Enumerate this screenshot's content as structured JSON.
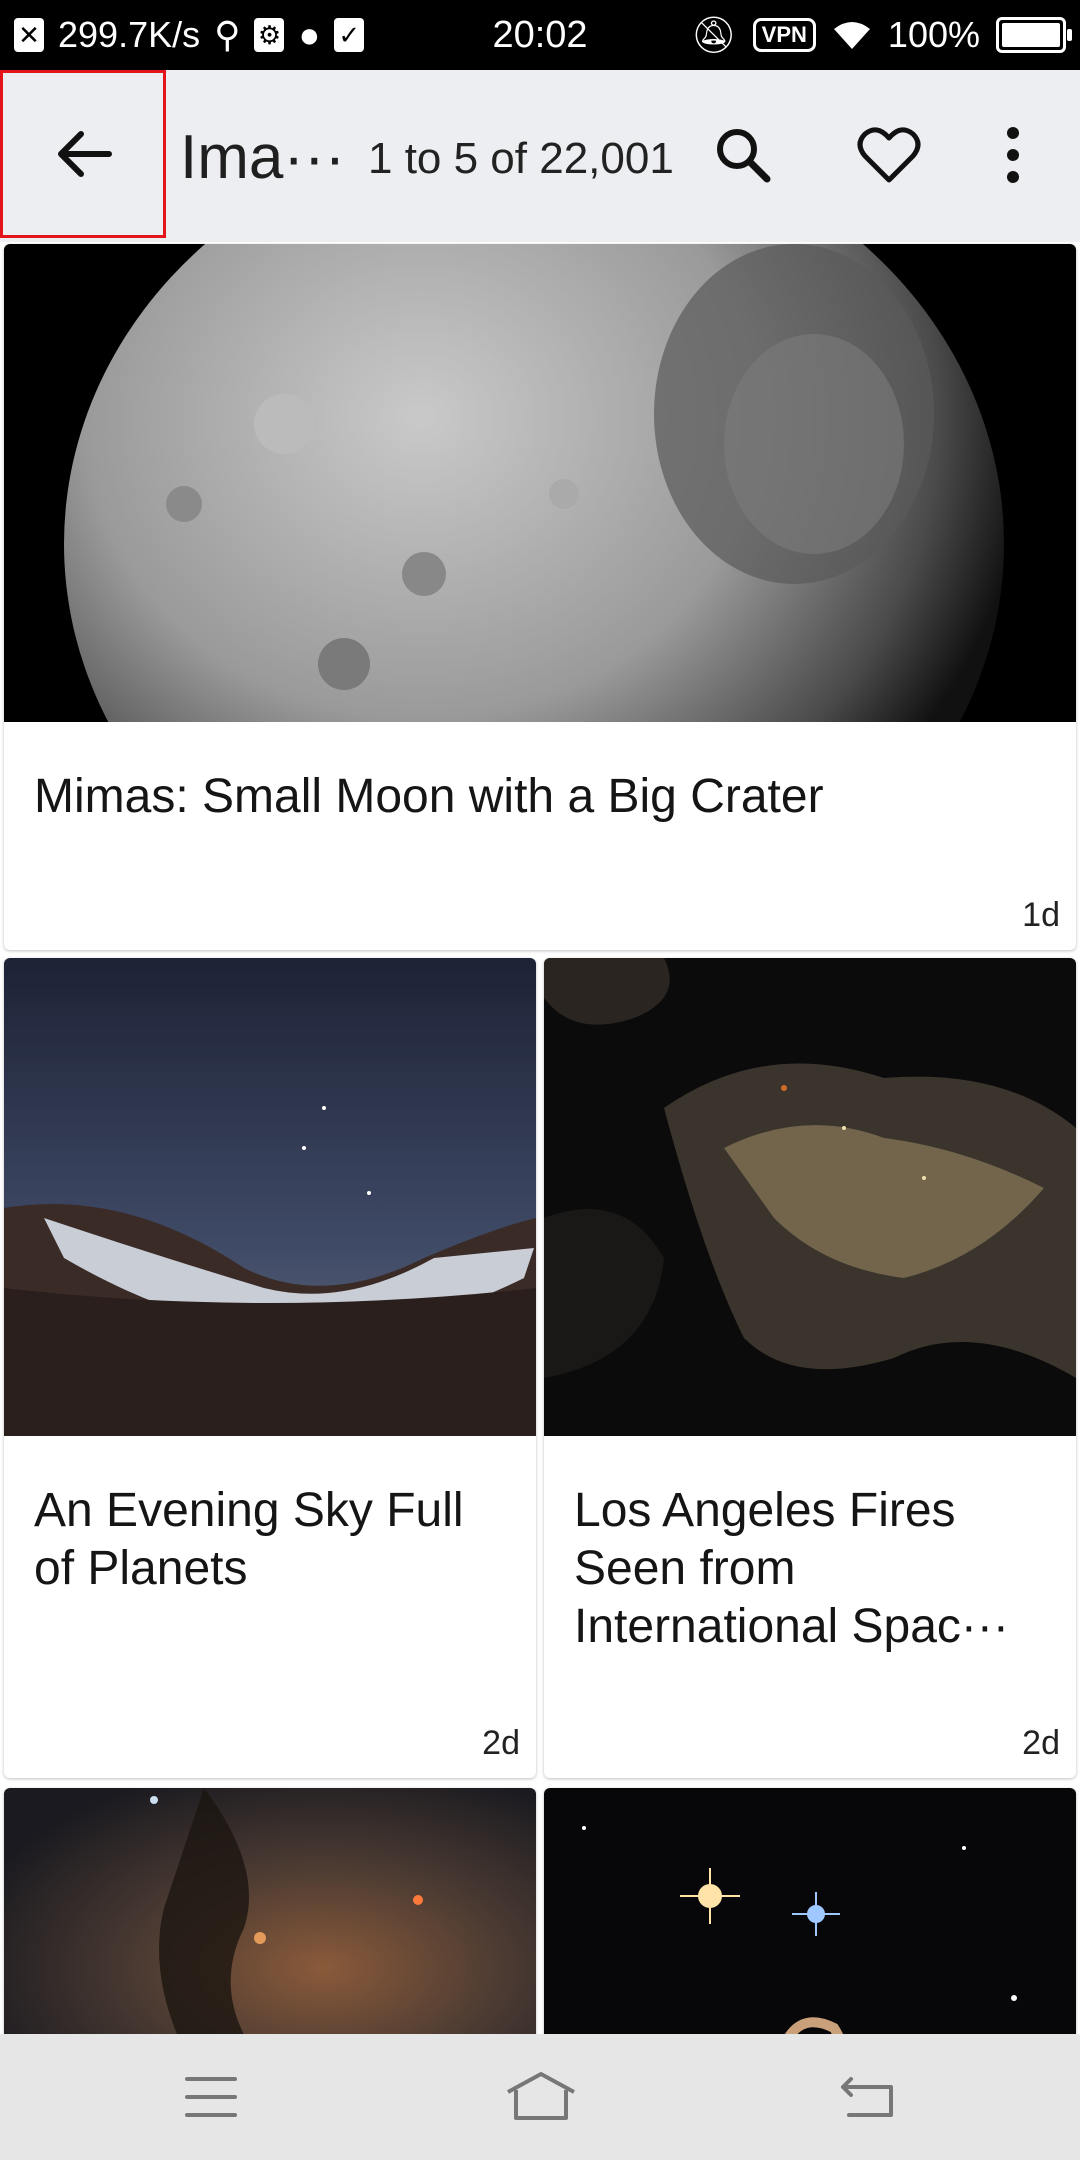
{
  "status": {
    "speed": "299.7K/s",
    "time": "20:02",
    "vpn": "VPN",
    "battery": "100%"
  },
  "app_bar": {
    "title": "Ima···",
    "count": "1 to 5 of 22,001",
    "icons": [
      "back-arrow-icon",
      "search-icon",
      "heart-icon",
      "more-vert-icon"
    ]
  },
  "cards": [
    {
      "title": "Mimas: Small Moon with a Big Crater",
      "age": "1d"
    },
    {
      "title": "An Evening Sky Full of Planets",
      "age": "2d"
    },
    {
      "title": "Los Angeles Fires Seen from International Spac···",
      "age": "2d"
    }
  ],
  "nav": {
    "icons": [
      "menu-icon",
      "home-icon",
      "back-icon"
    ]
  },
  "colors": {
    "app_bar_bg": "#eceef1",
    "highlight": "#e3151b",
    "nav_bg": "#e6e6e6"
  }
}
